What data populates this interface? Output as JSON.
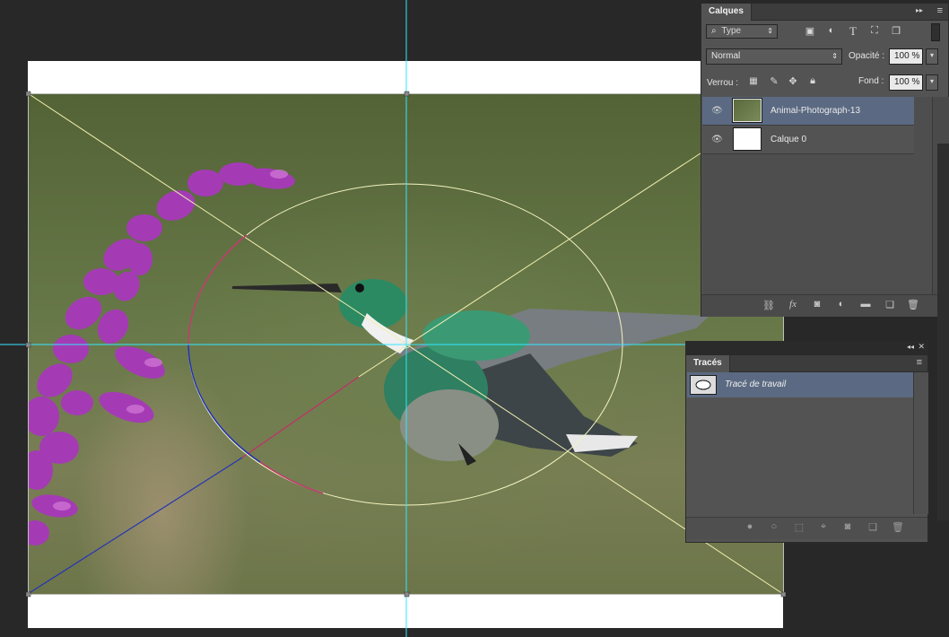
{
  "layers_panel": {
    "tab_label": "Calques",
    "menu_glyph": "≡",
    "collapse_glyph": "▸▸",
    "filter_value": "Type",
    "blend_mode": "Normal",
    "opacity_label": "Opacité :",
    "opacity_value": "100 %",
    "lock_label": "Verrou :",
    "fill_label": "Fond :",
    "fill_value": "100 %",
    "filter_icons": [
      "image-filter-icon",
      "adjustment-filter-icon",
      "text-filter-icon",
      "shape-filter-icon",
      "smart-object-filter-icon"
    ],
    "lock_icons": [
      "lock-pixels-icon",
      "lock-paint-icon",
      "lock-position-icon",
      "lock-all-icon"
    ],
    "layers": [
      {
        "name": "Animal-Photograph-13",
        "selected": true
      },
      {
        "name": "Calque 0",
        "selected": false
      }
    ],
    "footer_icons": [
      "link-icon",
      "fx-icon",
      "mask-icon",
      "adjustment-layer-icon",
      "group-folder-icon",
      "new-layer-icon",
      "trash-icon"
    ]
  },
  "paths_panel": {
    "tab_label": "Tracés",
    "menu_glyph": "≡",
    "collapse_glyph": "◂◂",
    "close_glyph": "✕",
    "paths": [
      {
        "name": "Tracé de travail",
        "selected": true
      }
    ],
    "footer_icons": [
      "fill-path-icon",
      "stroke-path-icon",
      "path-to-selection-icon",
      "selection-to-path-icon",
      "add-mask-icon",
      "new-path-icon",
      "trash-icon"
    ]
  },
  "colors": {
    "app_bg": "#282828",
    "panel_bg": "#535353",
    "selected_row": "#5b6a82",
    "guide": "#33e6ff",
    "path_yellow": "#f4f4b0",
    "path_blue": "#1f2fb0",
    "path_magenta": "#c0306a",
    "flower": "#a83cb8"
  }
}
